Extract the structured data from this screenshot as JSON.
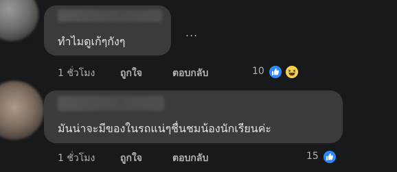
{
  "comments": [
    {
      "text": "ทำไมดูเก้ๆกังๆ",
      "time": "1 ชั่วโมง",
      "like_label": "ถูกใจ",
      "reply_label": "ตอบกลับ",
      "reaction_count": "10",
      "reactions": [
        "like-icon",
        "haha-icon"
      ],
      "more_label": "..."
    },
    {
      "text": "มันน่าจะมีของในรถแน่ๆชื่นชมน้องนักเรียนค่ะ",
      "time": "1 ชั่วโมง",
      "like_label": "ถูกใจ",
      "reply_label": "ตอบกลับ",
      "reaction_count": "15",
      "reactions": [
        "like-icon"
      ]
    }
  ],
  "colors": {
    "background": "#18191a",
    "bubble": "#3a3b3c",
    "text": "#e4e6eb",
    "meta": "#b0b3b8",
    "like_blue": "#2e89ff",
    "haha_yellow": "#f7d14a"
  }
}
